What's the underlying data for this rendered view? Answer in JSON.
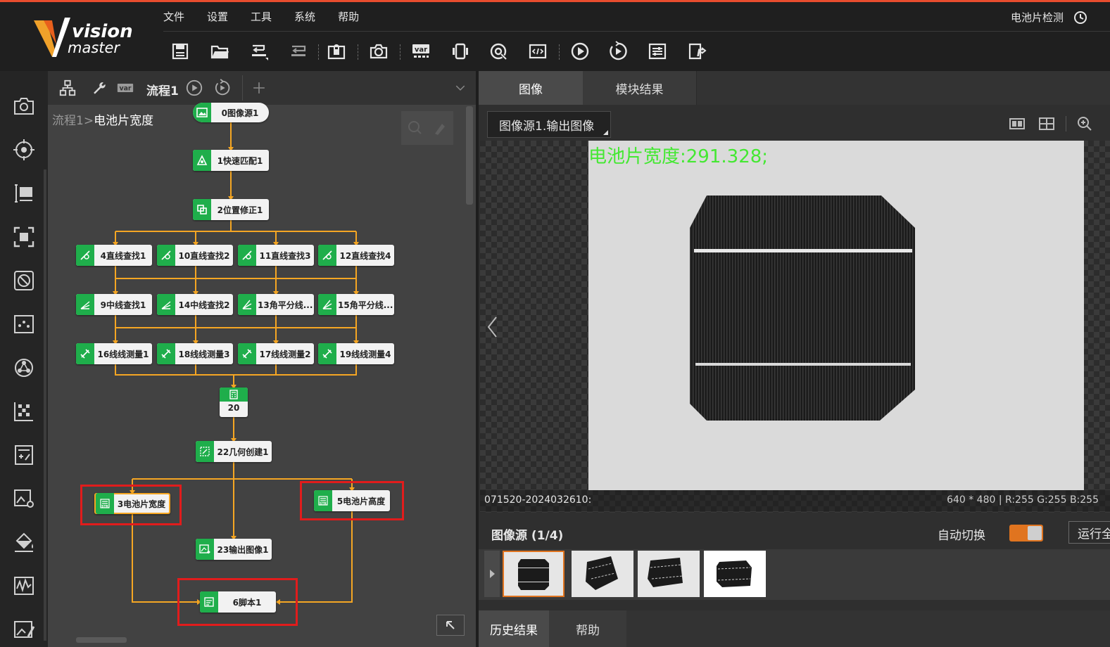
{
  "app": {
    "logo_line1": "vision",
    "logo_line2": "master",
    "title_right": "电池片检测"
  },
  "menu": [
    "文件",
    "设置",
    "工具",
    "系统",
    "帮助"
  ],
  "toolbar": [
    {
      "icon": "save-icon"
    },
    {
      "icon": "open-folder-icon"
    },
    {
      "icon": "undo-save-icon"
    },
    {
      "icon": "redo-save-icon"
    },
    {
      "icon": "lock-icon"
    },
    {
      "icon": "camera-icon"
    },
    {
      "icon": "variable-icon",
      "label": "var"
    },
    {
      "icon": "device-icon"
    },
    {
      "icon": "target-icon"
    },
    {
      "icon": "code-window-icon"
    },
    {
      "icon": "run-once-icon"
    },
    {
      "icon": "run-loop-icon"
    },
    {
      "icon": "settings-sliders-icon"
    },
    {
      "icon": "format-icon"
    }
  ],
  "flow": {
    "tab_label": "流程1",
    "var_label": "var",
    "breadcrumb_parent": "流程1",
    "breadcrumb_sep": ">",
    "breadcrumb_current": "电池片宽度",
    "nodes": {
      "n0": "0图像源1",
      "n1": "1快速匹配1",
      "n2": "2位置修正1",
      "n4": "4直线查找1",
      "n10": "10直线查找2",
      "n11": "11直线查找3",
      "n12": "12直线查找4",
      "n9": "9中线查找1",
      "n14": "14中线查找2",
      "n13": "13角平分线...",
      "n15": "15角平分线...",
      "n16": "16线线测量1",
      "n18": "18线线测量3",
      "n17": "17线线测量2",
      "n19": "19线线测量4",
      "n20": "20",
      "n22": "22几何创建1",
      "n3": "3电池片宽度",
      "n5": "5电池片高度",
      "n23": "23输出图像1",
      "n6": "6脚本1"
    }
  },
  "right": {
    "tabs": [
      "图像",
      "模块结果"
    ],
    "image_select": "图像源1.输出图像",
    "overlay_text": "电池片宽度:291.328;",
    "status_left": "071520-2024032610:",
    "status_right": "640 * 480  |  R:255  G:255  B:255",
    "thumb_title": "图像源 (1/4)",
    "auto_switch_label": "自动切换",
    "auto_switch_on": true,
    "run_label": "运行全",
    "bottom_tabs": [
      "历史结果",
      "帮助"
    ]
  },
  "colors": {
    "accent_orange": "#e0741f",
    "node_green": "#1fae4b",
    "highlight_red": "#e11c1c",
    "overlay_green": "#44e832",
    "top_line": "#e84d2e"
  }
}
